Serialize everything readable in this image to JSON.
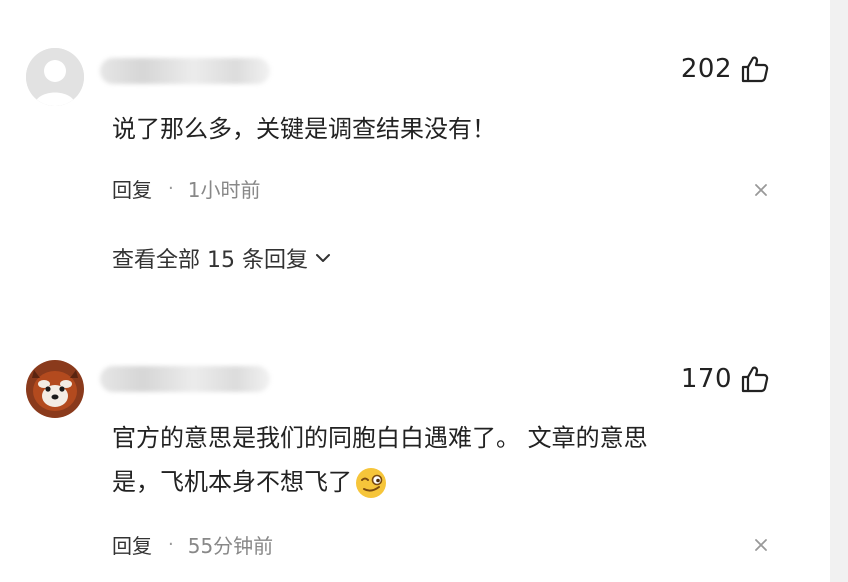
{
  "comments": [
    {
      "likes": "202",
      "text": "说了那么多，关键是调查结果没有！",
      "reply_label": "回复",
      "separator": "·",
      "time": "1小时前",
      "view_replies": "查看全部 15 条回复"
    },
    {
      "likes": "170",
      "text_line1": "官方的意思是我们的同胞白白遇难了。 文章的意思",
      "text_line2": "是，飞机本身不想飞了",
      "reply_label": "回复",
      "separator": "·",
      "time": "55分钟前"
    }
  ],
  "icons": {
    "like": "thumbs-up-icon",
    "close": "close-icon",
    "expand": "chevron-down-icon",
    "emoji": "smirk-emoji-icon"
  },
  "colors": {
    "text": "#222222",
    "meta": "#888888",
    "avatar_bg": "#e2e2e2"
  }
}
